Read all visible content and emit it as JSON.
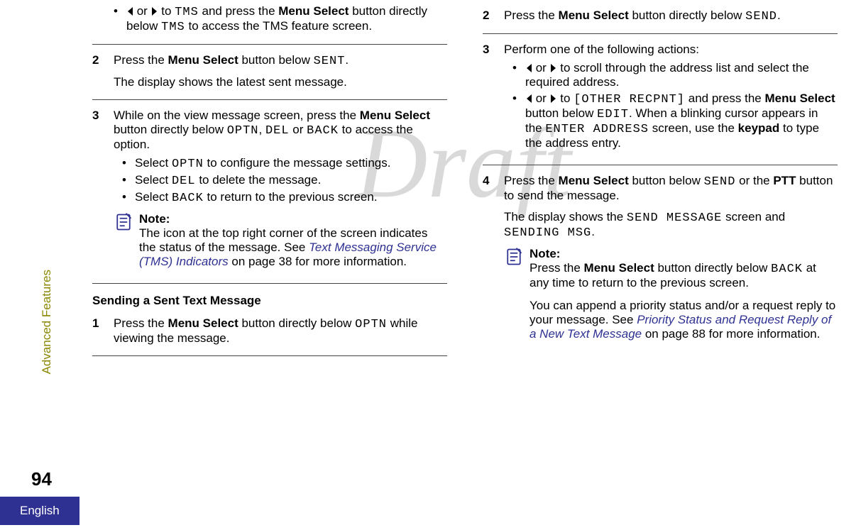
{
  "watermark": "Draft",
  "sidebar": "Advanced Features",
  "page_number": "94",
  "language": "English",
  "left": {
    "bullet1_a": " or ",
    "bullet1_b": " to ",
    "tms": "TMS",
    "bullet1_c": " and press the ",
    "menu_select": "Menu Select",
    "bullet1_d": " button directly below ",
    "bullet1_e": " to access the TMS feature screen.",
    "s2_a": "Press the ",
    "s2_b": " button below ",
    "sent": "SENT",
    "s2_c": ".",
    "s2_p": "The display shows the latest sent message.",
    "s3_a": "While on the view message screen, press the ",
    "s3_b": " button directly below ",
    "optn": "OPTN",
    "comma": ", ",
    "del": "DEL",
    "or": " or ",
    "back": "BACK",
    "s3_c": " to access the option.",
    "sub1_a": "Select ",
    "sub1_b": " to configure the message settings.",
    "sub2_a": "Select ",
    "sub2_b": " to delete the message.",
    "sub3_a": "Select ",
    "sub3_b": " to return to the previous screen.",
    "note_title": "Note:",
    "note_a": "The icon at the top right corner of the screen indicates the status of the message. See ",
    "note_link": "Text Messaging Service (TMS) Indicators",
    "note_b": " on page 38 for more information.",
    "heading": "Sending a Sent Text Message",
    "s1b_a": "Press the ",
    "s1b_b": " button directly below ",
    "s1b_c": " while viewing the message.",
    "n1": "1",
    "n2": "2",
    "n3": "3"
  },
  "right": {
    "s2_a": "Press the ",
    "menu_select": "Menu Select",
    "s2_b": " button directly below ",
    "send": "SEND",
    "s2_c": ".",
    "s3_a": "Perform one of the following actions:",
    "b1_a": " or ",
    "b1_b": " to scroll through the address list and select the required address.",
    "b2_a": " or ",
    "b2_b": " to ",
    "other": "[OTHER RECPNT]",
    "b2_c": " and press the ",
    "b2_d": " button below ",
    "edit": "EDIT",
    "b2_e": ". When a blinking cursor appears in the ",
    "enter_addr": "ENTER ADDRESS",
    "b2_f": " screen, use the ",
    "keypad": "keypad",
    "b2_g": " to type the address entry.",
    "s4_a": "Press the ",
    "s4_b": " button below ",
    "s4_c": " or the ",
    "ptt": "PTT",
    "s4_d": " button to send the message.",
    "s4_p_a": "The display shows the ",
    "send_message": "SEND MESSAGE",
    "s4_p_b": " screen and ",
    "sending_msg": "SENDING MSG",
    "s4_p_c": ".",
    "note_title": "Note:",
    "note_a": "Press the ",
    "note_b": " button directly below ",
    "back": "BACK",
    "note_c": " at any time to return to the previous screen.",
    "note2_a": "You can append a priority status and/or a request reply to your message. See ",
    "note2_link": "Priority Status and Request Reply of a New Text Message",
    "note2_b": " on page 88 for more information.",
    "n2": "2",
    "n3": "3",
    "n4": "4"
  }
}
